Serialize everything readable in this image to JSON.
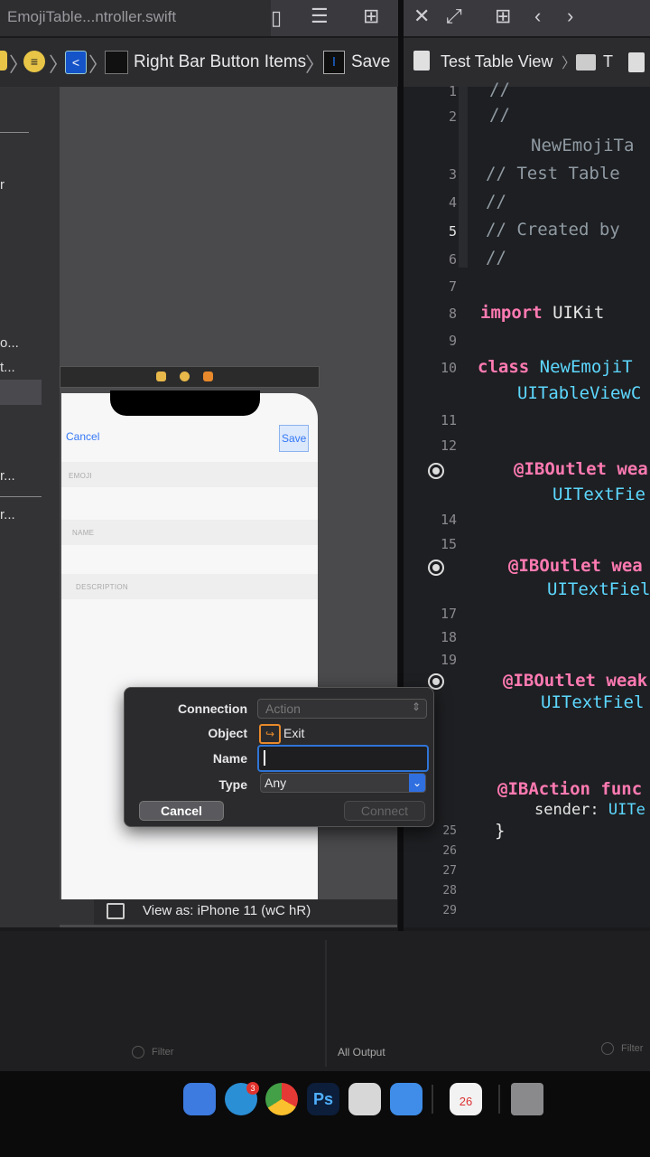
{
  "window": {
    "left_tab_label": "EmojiTable...ntroller.swift"
  },
  "jumpbar_left": {
    "item_label": "Right Bar Button Items",
    "selected_label": "Save"
  },
  "jumpbar_right": {
    "path_label": "Test Table View",
    "path_next": "T"
  },
  "sidebar": {
    "items": [
      "r",
      "o...",
      "t...",
      "r...",
      "r..."
    ]
  },
  "phone": {
    "cancel_label": "Cancel",
    "save_label": "Save",
    "fields": [
      "EMOJI",
      "NAME",
      "DESCRIPTION"
    ]
  },
  "popover": {
    "connection_label": "Connection",
    "connection_value": "Action",
    "object_label": "Object",
    "object_value": "Exit",
    "name_label": "Name",
    "name_value": "",
    "type_label": "Type",
    "type_value": "Any",
    "cancel_button": "Cancel",
    "connect_button": "Connect"
  },
  "canvas": {
    "view_as": "View as: iPhone 11 (wC hR)"
  },
  "debug": {
    "filter_left": "Filter",
    "output_select": "All Output",
    "filter_right": "Filter"
  },
  "dock": {
    "calendar_day": "26",
    "mail_badge": "3"
  },
  "editor": {
    "line_numbers": [
      "1",
      "2",
      "3",
      "4",
      "5",
      "6",
      "7",
      "8",
      "9",
      "10",
      "11",
      "12",
      "14",
      "15",
      "17",
      "18",
      "19",
      "25",
      "26",
      "27",
      "28",
      "29"
    ],
    "lines": {
      "l1": "//",
      "l2": "//",
      "l2b": "NewEmojiTa",
      "l3": "//  Test Table",
      "l4": "//",
      "l5": "//  Created by",
      "l6": "//",
      "import_kw": "import",
      "import_mod": "UIKit",
      "class_kw": "class",
      "class_name": "NewEmojiT",
      "class_super": "UITableViewC",
      "outlet1_kw": "@IBOutlet",
      "outlet1_weak": "wea",
      "outlet1_type": "UITextFie",
      "outlet2_kw": "@IBOutlet",
      "outlet2_weak": "wea",
      "outlet2_type": "UITextFiel",
      "outlet3_kw": "@IBOutlet",
      "outlet3_weak": "weak",
      "outlet3_type": "UITextFiel",
      "action_kw": "@IBAction",
      "action_func": "func",
      "action_sender": "sender:",
      "action_type": "UITe",
      "close_brace": "}"
    }
  },
  "colors": {
    "accent_blue": "#2f74d6",
    "keyword_pink": "#ff7ab2",
    "type_cyan": "#5dd8ff",
    "exit_orange": "#e8892b"
  }
}
